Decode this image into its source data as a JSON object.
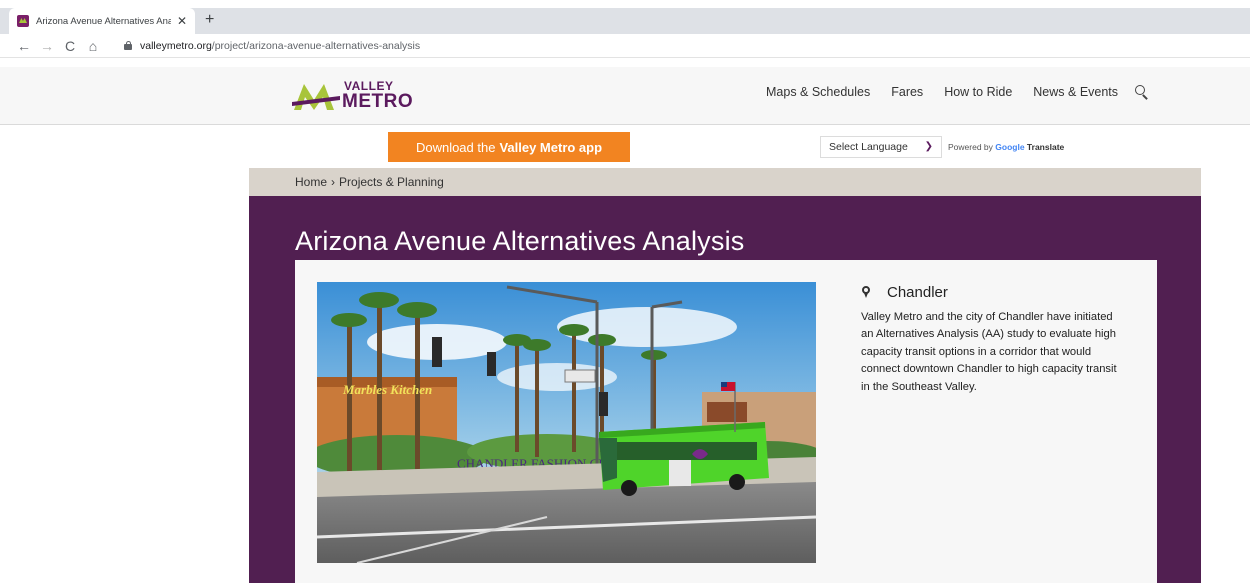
{
  "browser": {
    "tab_title": "Arizona Avenue Alternatives Ana",
    "close_symbol": "✕",
    "new_tab_symbol": "+",
    "back_symbol": "←",
    "forward_symbol": "→",
    "reload_symbol": "C",
    "home_symbol": "⌂",
    "url_host": "valleymetro.org",
    "url_path": "/project/arizona-avenue-alternatives-analysis"
  },
  "header": {
    "logo_top": "VALLEY",
    "logo_bottom": "METRO",
    "nav": [
      "Maps & Schedules",
      "Fares",
      "How to Ride",
      "News & Events"
    ]
  },
  "utility": {
    "app_banner_prefix": "Download the",
    "app_banner_bold": "Valley Metro app",
    "language_select": "Select Language",
    "powered_by": "Powered by",
    "google": "Google",
    "translate": "Translate"
  },
  "breadcrumb": {
    "home": "Home",
    "separator": "›",
    "current": "Projects & Planning"
  },
  "page": {
    "title": "Arizona Avenue Alternatives Analysis",
    "location": "Chandler",
    "description": "Valley Metro and the city of Chandler have initiated an Alternatives Analysis (AA) study to evaluate high capacity transit options in a corridor that would connect downtown Chandler to high capacity transit in the Southeast Valley.",
    "photo_signs": [
      "Marbles Kitchen",
      "CHANDLER FASHION CENTER"
    ]
  },
  "colors": {
    "brand_purple": "#511f51",
    "brand_green": "#a8c43a",
    "banner_orange": "#f28421",
    "breadcrumb_bg": "#d9d3cb"
  }
}
